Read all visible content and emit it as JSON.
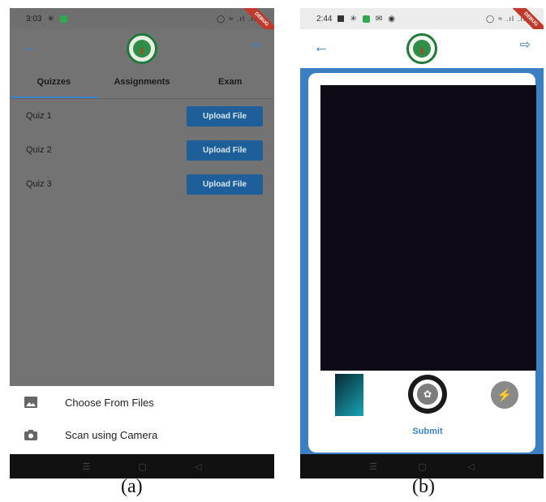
{
  "panel_a": {
    "status_time": "3:03",
    "debug_label": "DEBUG",
    "tabs": [
      "Quizzes",
      "Assignments",
      "Exam"
    ],
    "active_tab": "Quizzes",
    "quizzes": [
      {
        "name": "Quiz 1",
        "button": "Upload File"
      },
      {
        "name": "Quiz 2",
        "button": "Upload File"
      },
      {
        "name": "Quiz 3",
        "button": "Upload File"
      }
    ],
    "sheet_options": [
      {
        "icon": "image-icon",
        "label": "Choose From Files"
      },
      {
        "icon": "camera-icon",
        "label": "Scan using Camera"
      }
    ],
    "caption": "(a)"
  },
  "panel_b": {
    "status_time": "2:44",
    "debug_label": "DEBUG",
    "submit_label": "Submit",
    "caption": "(b)"
  },
  "colors": {
    "accent": "#3d84c6",
    "upload_button": "#1f5f99",
    "dim_background": "#737373",
    "camera_background": "#3a7fc1",
    "viewfinder": "#0f0b15"
  }
}
